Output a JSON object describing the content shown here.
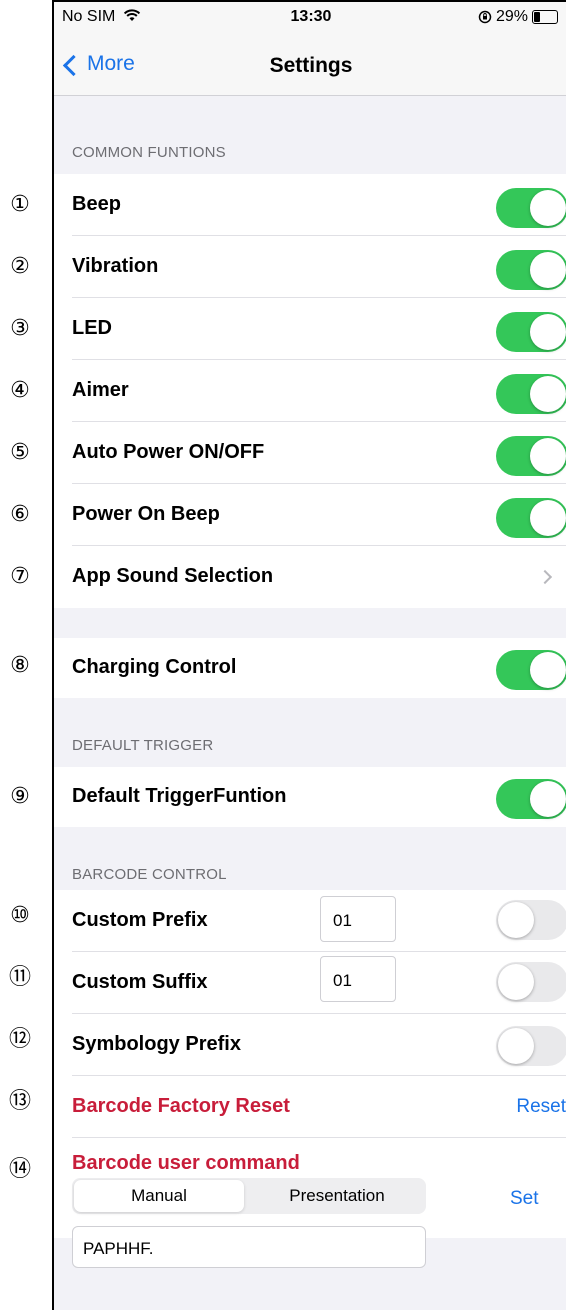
{
  "status_bar": {
    "carrier": "No SIM",
    "time": "13:30",
    "battery": "29%"
  },
  "nav": {
    "back_label": "More",
    "title": "Settings"
  },
  "row_numbers": [
    "①",
    "②",
    "③",
    "④",
    "⑤",
    "⑥",
    "⑦",
    "⑧",
    "⑨",
    "⑩",
    "⑪",
    "⑫",
    "⑬",
    "⑭"
  ],
  "sections": {
    "common": {
      "header": "COMMON FUNTIONS",
      "items": [
        {
          "label": "Beep",
          "on": true
        },
        {
          "label": "Vibration",
          "on": true
        },
        {
          "label": "LED",
          "on": true
        },
        {
          "label": "Aimer",
          "on": true
        },
        {
          "label": "Auto Power ON/OFF",
          "on": true
        },
        {
          "label": "Power On Beep",
          "on": true
        },
        {
          "label": "App Sound Selection"
        }
      ]
    },
    "charging": {
      "label": "Charging Control",
      "on": true
    },
    "default_trigger": {
      "header": "DEFAULT TRIGGER",
      "label": "Default TriggerFuntion",
      "on": true
    },
    "barcode": {
      "header": "BARCODE CONTROL",
      "custom_prefix": {
        "label": "Custom Prefix",
        "value": "01",
        "on": false
      },
      "custom_suffix": {
        "label": "Custom Suffix",
        "value": "01",
        "on": false
      },
      "symbology_prefix": {
        "label": "Symbology Prefix",
        "on": false
      },
      "factory_reset": {
        "label": "Barcode Factory Reset",
        "action": "Reset"
      },
      "user_command": {
        "label": "Barcode user command",
        "segments": [
          "Manual",
          "Presentation"
        ],
        "selected_segment": "Manual",
        "value": "PAPHHF.",
        "action": "Set"
      }
    }
  },
  "colors": {
    "accent": "#1a73e8",
    "toggle_on": "#34c759",
    "toggle_off": "#e9e9eb",
    "danger": "#c81d3a"
  }
}
